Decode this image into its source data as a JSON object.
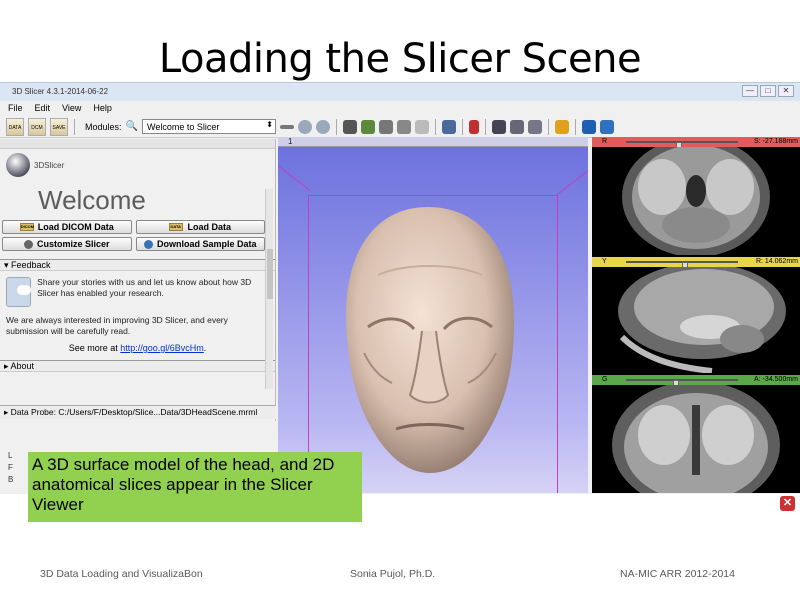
{
  "slide": {
    "title": "Loading the Slicer Scene",
    "caption": "A 3D surface model of the head, and 2D anatomical slices appear in the Slicer Viewer",
    "footer_left": "3D Data Loading and VisualizaBon",
    "footer_center": "Sonia Pujol, Ph.D.",
    "footer_right": "NA-MIC ARR 2012-2014"
  },
  "window": {
    "title": "3D Slicer 4.3.1-2014-06-22",
    "controls": [
      "—",
      "□",
      "✕"
    ]
  },
  "menu": [
    "File",
    "Edit",
    "View",
    "Help"
  ],
  "toolbar": {
    "data_label": "DATA",
    "dcm_label": "DCM",
    "save_label": "SAVE",
    "modules_label": "Modules:",
    "module_value": "Welcome to Slicer"
  },
  "panel": {
    "logo_text": "3DSlicer",
    "welcome": "Welcome",
    "buttons": {
      "load_dicom": "Load DICOM Data",
      "load_data": "Load Data",
      "customize": "Customize Slicer",
      "download_sample": "Download Sample Data",
      "dicom_icon_text": "DICOM",
      "data_icon_text": "DATA"
    },
    "feedback": {
      "header": "Feedback",
      "text1": "Share your stories with us and let us know about how 3D Slicer has enabled your research.",
      "text2": "We are always interested in improving 3D Slicer, and every submission will be carefully read.",
      "see_more": "See more at ",
      "link": "http://goo.gl/6BvcHm",
      "link_suffix": "."
    },
    "about_header": "About",
    "data_probe": "Data Probe: C:/Users/F/Desktop/Slice...Data/3DHeadScene.mrml",
    "lfb": [
      "L",
      "F",
      "B"
    ]
  },
  "view3d": {
    "label": "1"
  },
  "slice_views": [
    {
      "letter": "R",
      "value": "S: -27.188mm",
      "color": "#e35b5b",
      "knob": 0.45
    },
    {
      "letter": "Y",
      "value": "R: 14.062mm",
      "color": "#e7d54a",
      "knob": 0.5
    },
    {
      "letter": "G",
      "value": "A: -34.500mm",
      "color": "#5aa84a",
      "knob": 0.42
    }
  ]
}
